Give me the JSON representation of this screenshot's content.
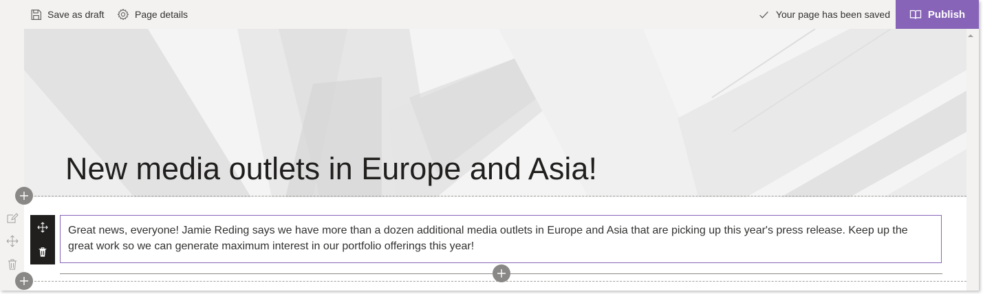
{
  "toolbar": {
    "save_draft_label": "Save as draft",
    "page_details_label": "Page details",
    "saved_status": "Your page has been saved",
    "publish_label": "Publish"
  },
  "icons": {
    "save": "floppy-disk-icon",
    "details": "gear-icon",
    "check": "checkmark-icon",
    "publish": "open-book-icon",
    "edit": "edit-icon",
    "move": "move-icon",
    "delete": "trash-icon",
    "add": "plus-icon"
  },
  "page": {
    "title": "New media outlets in Europe and Asia!",
    "body_text": "Great news, everyone! Jamie Reding says we have more than a dozen additional media outlets in Europe and Asia that are picking up this year's press release. Keep up the great work so we can generate maximum interest in our portfolio offerings this year!"
  },
  "colors": {
    "accent": "#8764b8",
    "chrome": "#f3f2f1",
    "toolbar_dark": "#201f1e",
    "add_button": "#8a8886"
  }
}
